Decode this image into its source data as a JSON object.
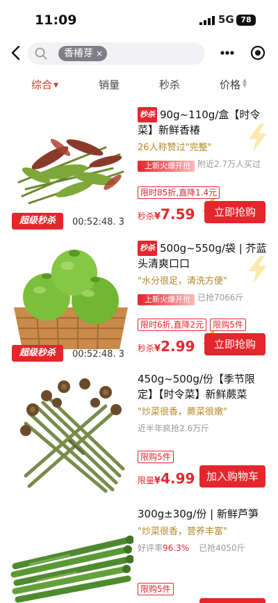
{
  "status_bar": {
    "time": "11:09",
    "network": "5G",
    "battery": "78"
  },
  "search": {
    "query_chip": "香椿芽",
    "clear_glyph": "×"
  },
  "sort_tabs": [
    {
      "label": "综合",
      "active": true
    },
    {
      "label": "销量",
      "active": false
    },
    {
      "label": "秒杀",
      "active": false
    },
    {
      "label": "价格",
      "active": false
    }
  ],
  "products": [
    {
      "seckill_tag": "秒杀",
      "title": "90g~110g/盒【时令菜】新鲜香椿",
      "review": "26人称赞过\"完整\"",
      "fire_tag": "上新火爆开抢",
      "stat": "附近2.7万人买过",
      "deal_tags": [
        "限时85折,直降1.4元"
      ],
      "price_prefix": "秒杀",
      "currency": "¥",
      "price": "7.59",
      "button": "立即抢购",
      "badge": "超级秒杀",
      "countdown": "00:52:48. 3"
    },
    {
      "seckill_tag": "秒杀",
      "title": "500g~550g/袋 | 芥蓝头清爽口口",
      "review": "\"水分很足，清洗方便\"",
      "fire_tag": "上新火爆开抢",
      "stat": "已抢7066斤",
      "deal_tags": [
        "限时6折,直降2元",
        "限购5件"
      ],
      "price_prefix": "秒杀",
      "currency": "¥",
      "price": "2.99",
      "button": "立即抢购",
      "badge": "超级秒杀",
      "countdown": "00:52:48. 3"
    },
    {
      "title": "450g~500g/份【季节限定】【时令菜】新鲜蕨菜",
      "review": "\"炒菜很香，蕨菜很嫩\"",
      "stat": "近半年疯抢2.6万斤",
      "deal_tags": [
        "限购5件"
      ],
      "price_prefix": "限量",
      "currency": "¥",
      "price": "4.99",
      "button": "加入购物车"
    },
    {
      "title": "300g±30g/份 | 新鲜芦笋",
      "review": "\"炒菜很香，营养丰富\"",
      "stat_prefix": "好评率",
      "stat_highlight": "96.3%",
      "stat": "已抢4050斤",
      "deal_tags": [
        "限购5件"
      ]
    }
  ],
  "colors": {
    "accent": "#e5262c",
    "review": "#b6882a",
    "bolt": "#f6c21a"
  },
  "icons": [
    "back-arrow-icon",
    "search-icon",
    "more-dots-icon",
    "target-icon",
    "lightning-icon"
  ]
}
